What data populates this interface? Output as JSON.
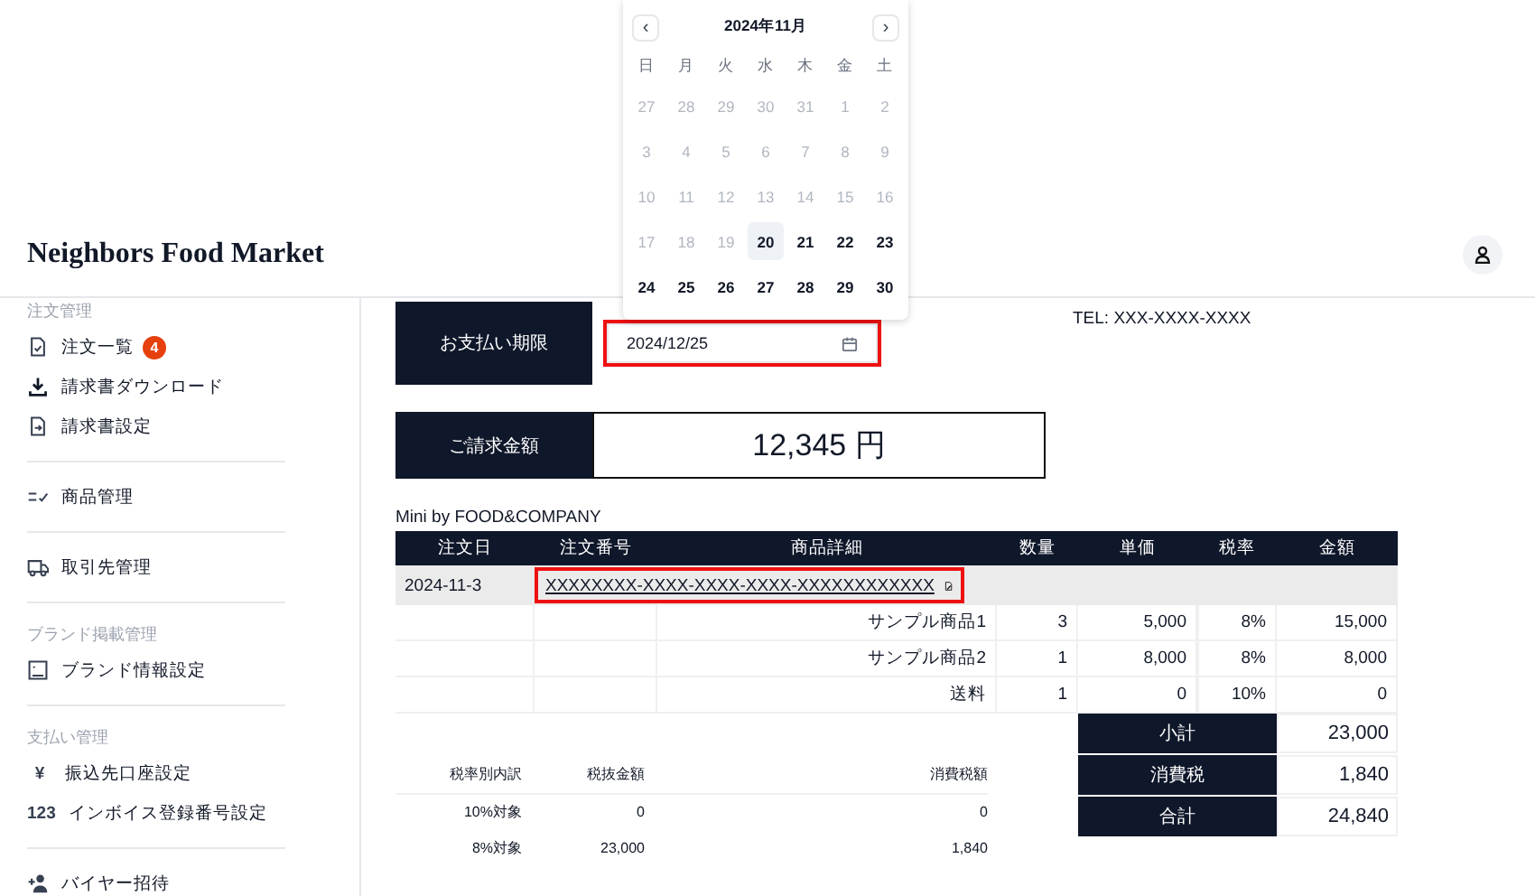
{
  "calendar": {
    "title": "2024年11月",
    "prev": "‹",
    "next": "›",
    "weekdays": [
      "日",
      "月",
      "火",
      "水",
      "木",
      "金",
      "土"
    ],
    "weeks": [
      [
        {
          "day": "27",
          "disabled": true,
          "selected": false
        },
        {
          "day": "28",
          "disabled": true,
          "selected": false
        },
        {
          "day": "29",
          "disabled": true,
          "selected": false
        },
        {
          "day": "30",
          "disabled": true,
          "selected": false
        },
        {
          "day": "31",
          "disabled": true,
          "selected": false
        },
        {
          "day": "1",
          "disabled": true,
          "selected": false
        },
        {
          "day": "2",
          "disabled": true,
          "selected": false
        }
      ],
      [
        {
          "day": "3",
          "disabled": true,
          "selected": false
        },
        {
          "day": "4",
          "disabled": true,
          "selected": false
        },
        {
          "day": "5",
          "disabled": true,
          "selected": false
        },
        {
          "day": "6",
          "disabled": true,
          "selected": false
        },
        {
          "day": "7",
          "disabled": true,
          "selected": false
        },
        {
          "day": "8",
          "disabled": true,
          "selected": false
        },
        {
          "day": "9",
          "disabled": true,
          "selected": false
        }
      ],
      [
        {
          "day": "10",
          "disabled": true,
          "selected": false
        },
        {
          "day": "11",
          "disabled": true,
          "selected": false
        },
        {
          "day": "12",
          "disabled": true,
          "selected": false
        },
        {
          "day": "13",
          "disabled": true,
          "selected": false
        },
        {
          "day": "14",
          "disabled": true,
          "selected": false
        },
        {
          "day": "15",
          "disabled": true,
          "selected": false
        },
        {
          "day": "16",
          "disabled": true,
          "selected": false
        }
      ],
      [
        {
          "day": "17",
          "disabled": true,
          "selected": false
        },
        {
          "day": "18",
          "disabled": true,
          "selected": false
        },
        {
          "day": "19",
          "disabled": true,
          "selected": false
        },
        {
          "day": "20",
          "disabled": false,
          "selected": true
        },
        {
          "day": "21",
          "disabled": false,
          "selected": false
        },
        {
          "day": "22",
          "disabled": false,
          "selected": false
        },
        {
          "day": "23",
          "disabled": false,
          "selected": false
        }
      ],
      [
        {
          "day": "24",
          "disabled": false,
          "selected": false
        },
        {
          "day": "25",
          "disabled": false,
          "selected": false
        },
        {
          "day": "26",
          "disabled": false,
          "selected": false
        },
        {
          "day": "27",
          "disabled": false,
          "selected": false
        },
        {
          "day": "28",
          "disabled": false,
          "selected": false
        },
        {
          "day": "29",
          "disabled": false,
          "selected": false
        },
        {
          "day": "30",
          "disabled": false,
          "selected": false
        }
      ]
    ]
  },
  "header": {
    "logo": "Neighbors Food Market"
  },
  "sidebar": {
    "sections": [
      {
        "title": "注文管理",
        "items": [
          {
            "label": "注文一覧",
            "kind": "doc-check",
            "badge": "4"
          },
          {
            "label": "請求書ダウンロード",
            "kind": "download"
          },
          {
            "label": "請求書設定",
            "kind": "doc-arrow"
          }
        ]
      },
      {
        "items": [
          {
            "label": "商品管理",
            "kind": "checklist"
          }
        ]
      },
      {
        "items": [
          {
            "label": "取引先管理",
            "kind": "truck"
          }
        ]
      },
      {
        "title": "ブランド掲載管理",
        "items": [
          {
            "label": "ブランド情報設定",
            "kind": "image"
          }
        ]
      },
      {
        "title": "支払い管理",
        "items": [
          {
            "label": "振込先口座設定",
            "kind": "glyph",
            "glyph": "¥"
          },
          {
            "label": "インボイス登録番号設定",
            "kind": "glyph",
            "glyph": "123"
          }
        ]
      },
      {
        "items": [
          {
            "label": "バイヤー招待",
            "kind": "person-add"
          }
        ]
      }
    ]
  },
  "invoice": {
    "due_label": "お支払い期限",
    "due_date": "2024/12/25",
    "tel": "TEL: XXX-XXXX-XXXX",
    "amount_label": "ご請求金額",
    "amount": "12,345 円",
    "brand": "Mini by FOOD&COMPANY",
    "columns": [
      "注文日",
      "注文番号",
      "商品詳細",
      "数量",
      "単価",
      "税率",
      "金額"
    ],
    "order": {
      "date": "2024-11-3",
      "number": "XXXXXXXX-XXXX-XXXX-XXXX-XXXXXXXXXXXX"
    },
    "rows": [
      [
        "",
        "",
        "サンプル商品1",
        "3",
        "5,000",
        "8%",
        "15,000"
      ],
      [
        "",
        "",
        "サンプル商品2",
        "1",
        "8,000",
        "8%",
        "8,000"
      ],
      [
        "",
        "",
        "送料",
        "1",
        "0",
        "10%",
        "0"
      ]
    ],
    "tax_columns": [
      "税率別内訳",
      "税抜金額",
      "消費税額"
    ],
    "tax_rows": [
      [
        "10%対象",
        "0",
        "0"
      ],
      [
        "8%対象",
        "23,000",
        "1,840"
      ]
    ],
    "totals": [
      {
        "label": "小計",
        "value": "23,000"
      },
      {
        "label": "消費税",
        "value": "1,840"
      },
      {
        "label": "合計",
        "value": "24,840"
      }
    ]
  }
}
